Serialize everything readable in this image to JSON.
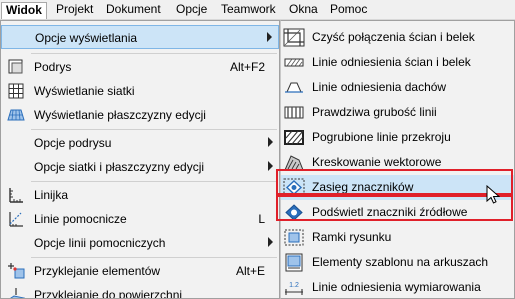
{
  "menubar": {
    "items": [
      "Widok",
      "Projekt",
      "Dokument",
      "Opcje",
      "Teamwork",
      "Okna",
      "Pomoc"
    ],
    "active": "Widok"
  },
  "main_menu": {
    "items": [
      {
        "label": "Opcje wyświetlania",
        "shortcut": "",
        "has_submenu": true,
        "highlighted": true
      },
      {
        "label": "Podrys",
        "shortcut": "Alt+F2",
        "icon": "podrys-icon"
      },
      {
        "label": "Wyświetlanie siatki",
        "shortcut": "",
        "icon": "grid-icon"
      },
      {
        "label": "Wyświetlanie płaszczyzny edycji",
        "shortcut": "",
        "icon": "edit-plane-icon"
      },
      {
        "label": "Opcje podrysu",
        "shortcut": "",
        "has_submenu": true
      },
      {
        "label": "Opcje siatki i płaszczyzny edycji",
        "shortcut": "",
        "has_submenu": true
      },
      {
        "label": "Linijka",
        "shortcut": "",
        "icon": "ruler-icon"
      },
      {
        "label": "Linie pomocnicze",
        "shortcut": "L",
        "icon": "guide-lines-icon"
      },
      {
        "label": "Opcje linii pomocniczych",
        "shortcut": "",
        "has_submenu": true
      },
      {
        "label": "Przyklejanie elementów",
        "shortcut": "Alt+E",
        "icon": "snap-elements-icon"
      },
      {
        "label": "Przyklejanie do powierzchni",
        "shortcut": "",
        "icon": "snap-surface-icon"
      }
    ]
  },
  "sub_menu": {
    "items": [
      {
        "label": "Czyść połączenia ścian i belek",
        "icon": "clean-junctions-icon"
      },
      {
        "label": "Linie odniesienia ścian i belek",
        "icon": "wall-reference-lines-icon"
      },
      {
        "label": "Linie odniesienia dachów",
        "icon": "roof-reference-lines-icon"
      },
      {
        "label": "Prawdziwa grubość linii",
        "icon": "true-line-weight-icon"
      },
      {
        "label": "Pogrubione linie przekroju",
        "icon": "bold-cut-lines-icon"
      },
      {
        "label": "Kreskowanie wektorowe",
        "icon": "vector-hatch-icon"
      },
      {
        "label": "Zasięg znaczników",
        "icon": "marker-range-icon",
        "highlighted": true
      },
      {
        "label": "Podświetl znaczniki źródłowe",
        "icon": "highlight-source-markers-icon"
      },
      {
        "label": "Ramki rysunku",
        "icon": "drawing-frames-icon"
      },
      {
        "label": "Elementy szablonu na arkuszach",
        "icon": "master-layout-elements-icon"
      },
      {
        "label": "Linie odniesienia wymiarowania",
        "icon": "dimension-reference-lines-icon"
      }
    ]
  },
  "colors": {
    "highlight": "#cce4f7",
    "annotation_box": "#e0202a",
    "icon_blue": "#2a6ebb"
  }
}
